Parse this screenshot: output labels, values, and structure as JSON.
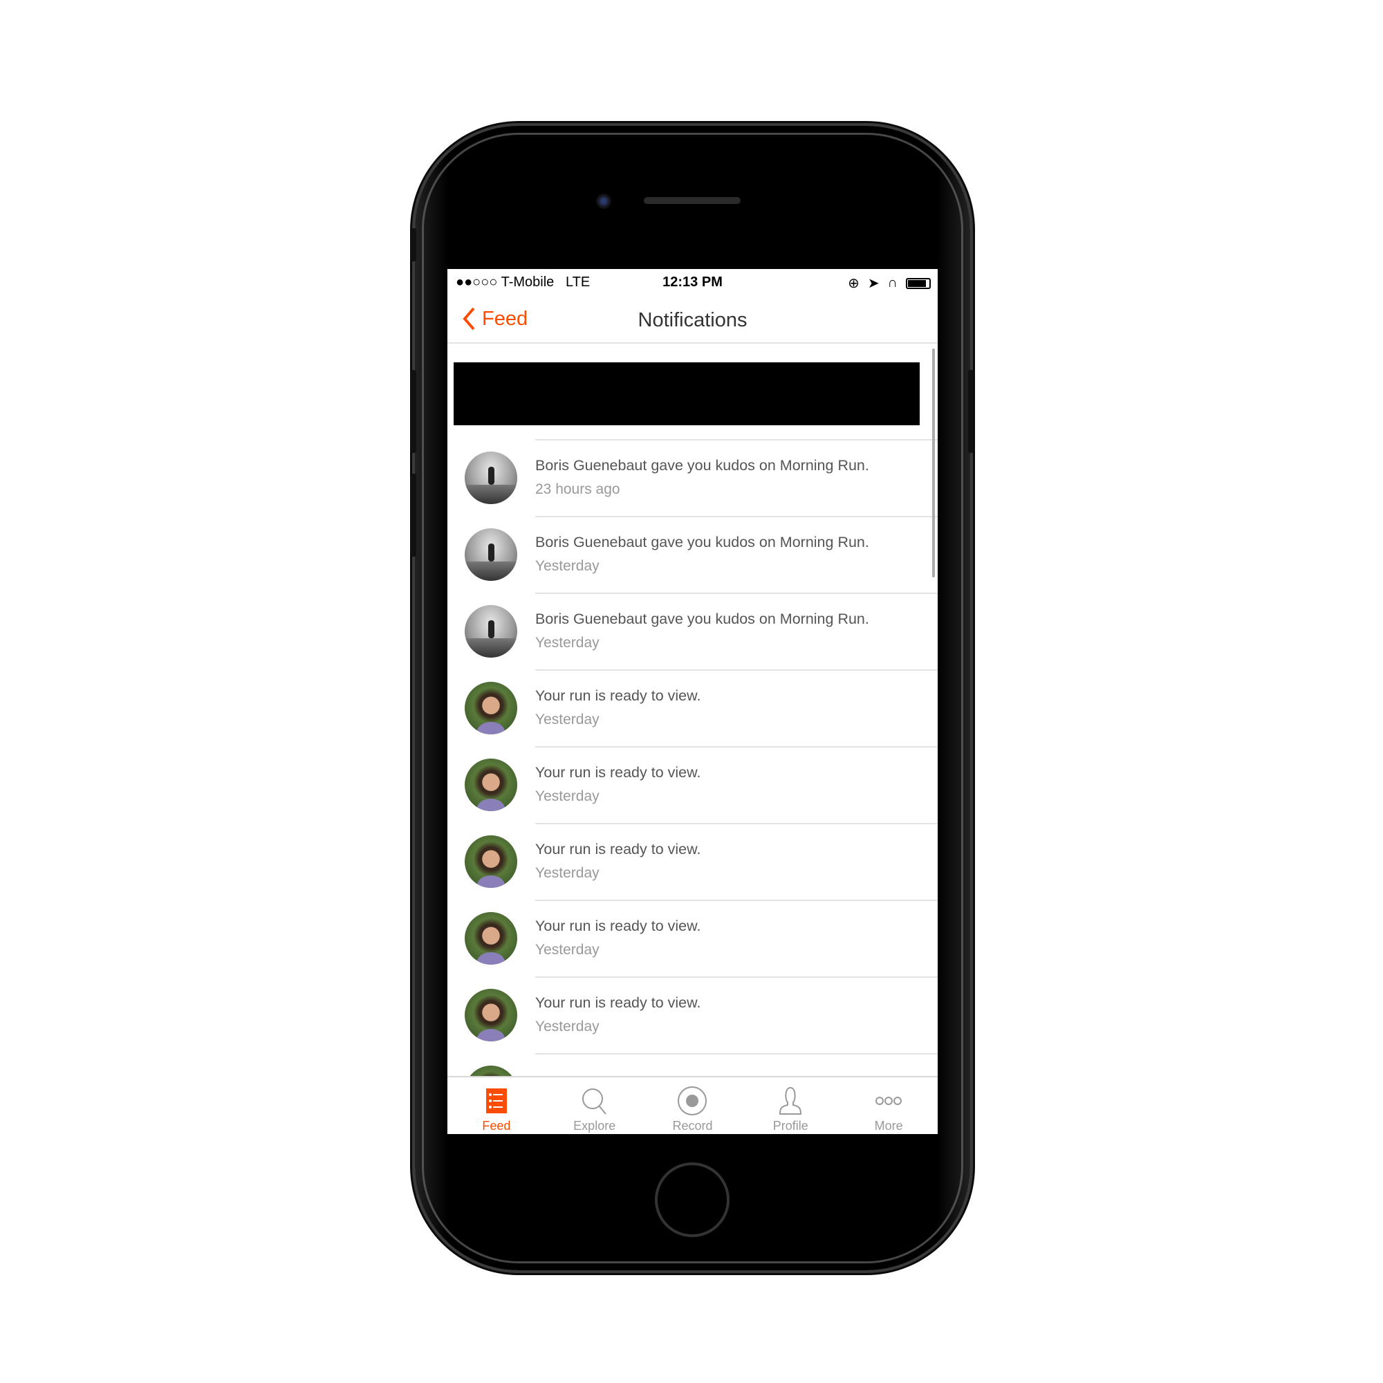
{
  "status_bar": {
    "signal": "●●○○○",
    "carrier": "T-Mobile",
    "network": "LTE",
    "time": "12:13 PM",
    "icons": [
      "rotation-lock-icon",
      "location-icon",
      "headphones-icon",
      "battery-icon"
    ],
    "battery_level": 0.8
  },
  "nav": {
    "back_label": "Feed",
    "title": "Notifications"
  },
  "accent": "#fc4c02",
  "notifications": [
    {
      "text": "Boris Guenebaut gave you kudos on Morning Run.",
      "time": "23 hours ago",
      "avatar": "runner"
    },
    {
      "text": "Boris Guenebaut gave you kudos on Morning Run.",
      "time": "Yesterday",
      "avatar": "runner"
    },
    {
      "text": "Boris Guenebaut gave you kudos on Morning Run.",
      "time": "Yesterday",
      "avatar": "runner"
    },
    {
      "text": "Your run is ready to view.",
      "time": "Yesterday",
      "avatar": "user"
    },
    {
      "text": "Your run is ready to view.",
      "time": "Yesterday",
      "avatar": "user"
    },
    {
      "text": "Your run is ready to view.",
      "time": "Yesterday",
      "avatar": "user"
    },
    {
      "text": "Your run is ready to view.",
      "time": "Yesterday",
      "avatar": "user"
    },
    {
      "text": "Your run is ready to view.",
      "time": "Yesterday",
      "avatar": "user"
    }
  ],
  "tabs": [
    {
      "label": "Feed",
      "icon": "feed-icon",
      "active": true
    },
    {
      "label": "Explore",
      "icon": "search-icon"
    },
    {
      "label": "Record",
      "icon": "record-icon"
    },
    {
      "label": "Profile",
      "icon": "profile-icon"
    },
    {
      "label": "More",
      "icon": "more-icon"
    }
  ]
}
